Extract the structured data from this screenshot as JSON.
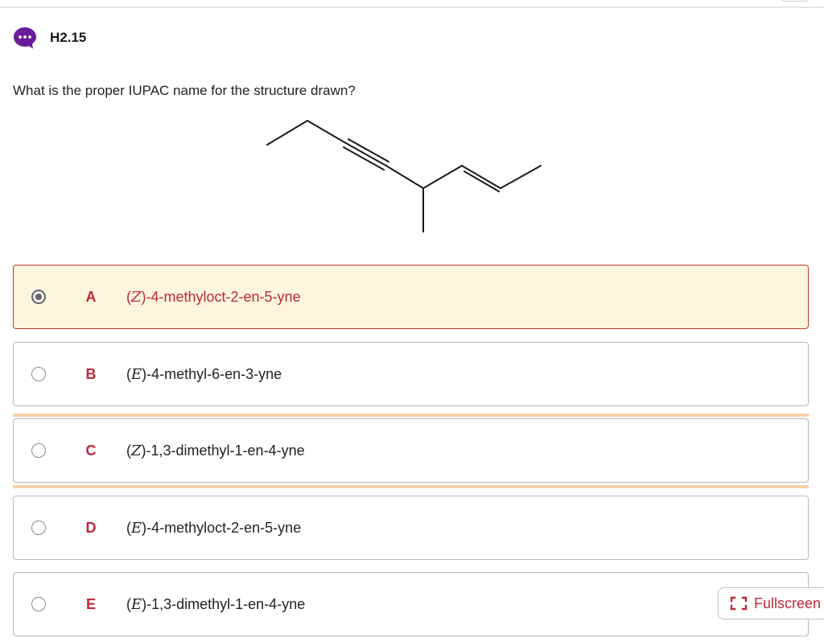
{
  "question": {
    "id": "H2.15",
    "prompt": "What is the proper IUPAC name for the structure drawn?"
  },
  "icons": {
    "chat": "chat-bubble-icon",
    "fullscreen": "fullscreen-icon"
  },
  "colors": {
    "accent": "#c0283a",
    "selected_bg": "#fdf6dd",
    "chat_icon": "#6a1b9a"
  },
  "choices": [
    {
      "letter": "A",
      "stereo": "Z",
      "name": ")-4-methyloct-2-en-5-yne",
      "selected": true
    },
    {
      "letter": "B",
      "stereo": "E",
      "name": ")-4-methyl-6-en-3-yne",
      "selected": false
    },
    {
      "letter": "C",
      "stereo": "Z",
      "name": ")-1,3-dimethyl-1-en-4-yne",
      "selected": false
    },
    {
      "letter": "D",
      "stereo": "E",
      "name": ")-4-methyloct-2-en-5-yne",
      "selected": false
    },
    {
      "letter": "E",
      "stereo": "E",
      "name": ")-1,3-dimethyl-1-en-4-yne",
      "selected": false
    }
  ],
  "fullscreen": {
    "label": "Fullscreen"
  }
}
